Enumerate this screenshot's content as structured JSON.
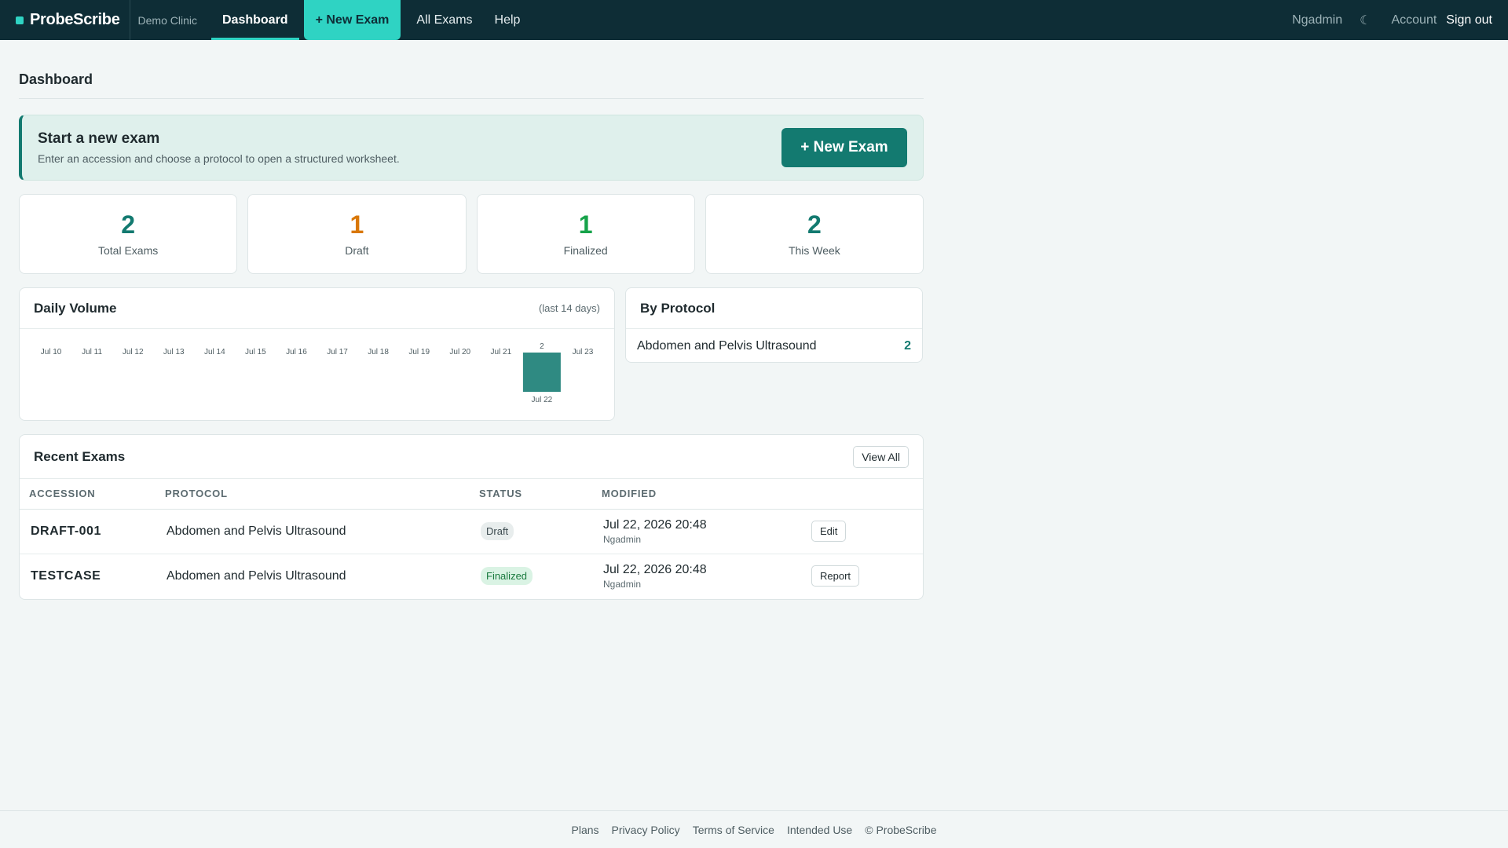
{
  "nav": {
    "brand": "ProbeScribe",
    "clinic": "Demo Clinic",
    "links": {
      "dashboard": "Dashboard",
      "new_exam": "+ New Exam",
      "all_exams": "All Exams",
      "help": "Help"
    },
    "user": "Ngadmin",
    "theme_icon": "☾",
    "account": "Account",
    "sign_out": "Sign out"
  },
  "page": {
    "title": "Dashboard"
  },
  "cta": {
    "title": "Start a new exam",
    "subtitle": "Enter an accession and choose a protocol to open a structured worksheet.",
    "button": "+ New Exam"
  },
  "stats": [
    {
      "value": "2",
      "label": "Total Exams",
      "color": "#137a70"
    },
    {
      "value": "1",
      "label": "Draft",
      "color": "#d97706"
    },
    {
      "value": "1",
      "label": "Finalized",
      "color": "#16a34a"
    },
    {
      "value": "2",
      "label": "This Week",
      "color": "#137a70"
    }
  ],
  "daily_volume": {
    "title": "Daily Volume",
    "note": "(last 14 days)"
  },
  "chart_data": {
    "type": "bar",
    "categories": [
      "Jul 10",
      "Jul 11",
      "Jul 12",
      "Jul 13",
      "Jul 14",
      "Jul 15",
      "Jul 16",
      "Jul 17",
      "Jul 18",
      "Jul 19",
      "Jul 20",
      "Jul 21",
      "Jul 22",
      "Jul 23"
    ],
    "values": [
      0,
      0,
      0,
      0,
      0,
      0,
      0,
      0,
      0,
      0,
      0,
      0,
      2,
      0
    ],
    "data_labels": [
      "",
      "",
      "",
      "",
      "",
      "",
      "",
      "",
      "",
      "",
      "",
      "",
      "2",
      ""
    ],
    "title": "Daily Volume",
    "bar_color": "#2f8a82",
    "grid": false,
    "legend": "none"
  },
  "by_protocol": {
    "title": "By Protocol",
    "items": [
      {
        "name": "Abdomen and Pelvis Ultrasound",
        "count": "2"
      }
    ]
  },
  "recent": {
    "title": "Recent Exams",
    "view_all": "View All",
    "columns": {
      "accession": "ACCESSION",
      "protocol": "PROTOCOL",
      "status": "STATUS",
      "modified": "MODIFIED"
    },
    "rows": [
      {
        "accession": "DRAFT-001",
        "protocol": "Abdomen and Pelvis Ultrasound",
        "status": "Draft",
        "modified": "Jul 22, 2026 20:48",
        "modified_by": "Ngadmin",
        "action": "Edit"
      },
      {
        "accession": "TESTCASE",
        "protocol": "Abdomen and Pelvis Ultrasound",
        "status": "Finalized",
        "modified": "Jul 22, 2026 20:48",
        "modified_by": "Ngadmin",
        "action": "Report"
      }
    ]
  },
  "footer": {
    "links": [
      "Plans",
      "Privacy Policy",
      "Terms of Service",
      "Intended Use",
      "© ProbeScribe"
    ]
  }
}
